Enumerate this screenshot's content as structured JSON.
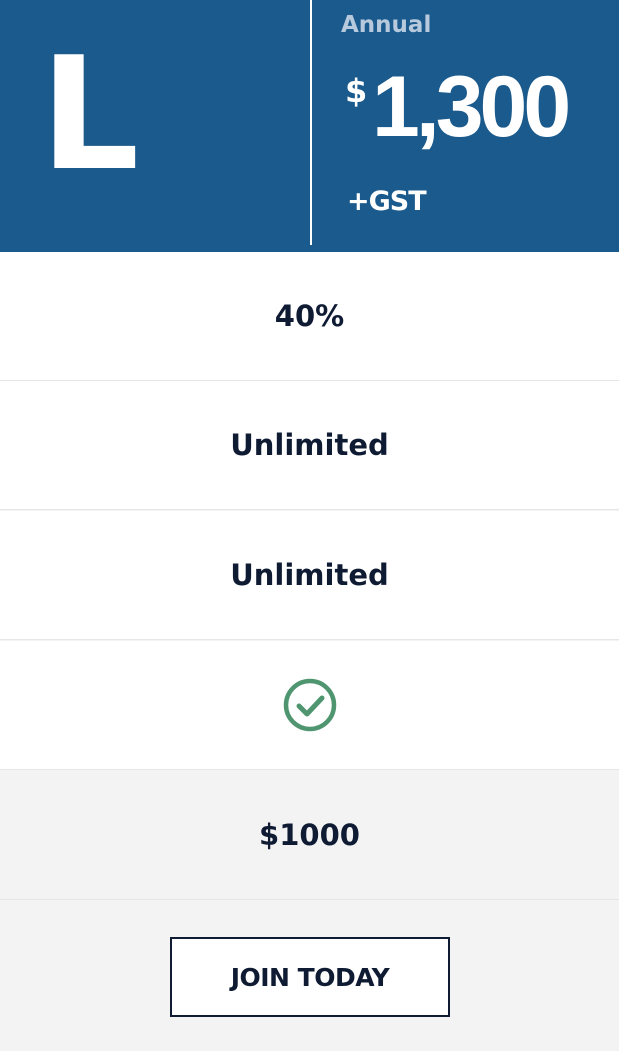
{
  "plan": {
    "tier_letter": "L",
    "period": "Annual",
    "currency_symbol": "$",
    "price": "1,300",
    "tax_note": "+GST"
  },
  "features": [
    {
      "value": "40%"
    },
    {
      "value": "Unlimited"
    },
    {
      "value": "Unlimited"
    },
    {
      "value": "",
      "icon": "check-circle-icon"
    },
    {
      "value": "$1000"
    }
  ],
  "cta": {
    "label": "JOIN TODAY"
  },
  "colors": {
    "header_bg": "#1b5a8c",
    "period_text": "#b7c9dc",
    "text_dark": "#0f1b33",
    "check_green": "#4f9670",
    "row_grey": "#f3f3f3"
  }
}
